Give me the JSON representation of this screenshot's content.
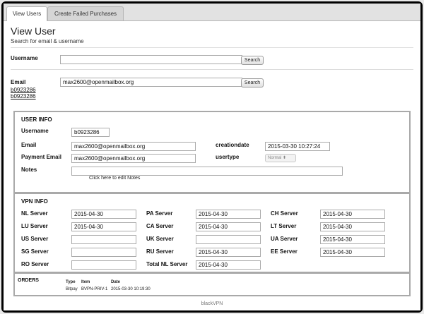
{
  "tabs": [
    {
      "label": "View Users",
      "active": true
    },
    {
      "label": "Create Failed Purchases",
      "active": false
    }
  ],
  "page": {
    "title": "View User",
    "subtitle": "Search for email & username"
  },
  "search": {
    "username_label": "Username",
    "username_value": "",
    "search_button": "Search",
    "email_label": "Email",
    "email_value": "max2600@openmailbox.org",
    "email_search_button": "Search",
    "results": [
      "b0923286",
      "b0923286"
    ]
  },
  "user_info": {
    "title": "USER INFO",
    "username_label": "Username",
    "username_value": "b0923286",
    "email_label": "Email",
    "email_value": "max2600@openmailbox.org",
    "payment_email_label": "Payment Email",
    "payment_email_value": "max2600@openmailbox.org",
    "notes_label": "Notes",
    "notes_value": "",
    "notes_hint": "Click here to edit Notes",
    "creationdate_label": "creationdate",
    "creationdate_value": "2015-03-30 10:27:24",
    "usertype_label": "usertype",
    "usertype_value": "Normal"
  },
  "vpn_info": {
    "title": "VPN INFO",
    "rows": [
      [
        {
          "label": "NL Server",
          "value": "2015-04-30"
        },
        {
          "label": "PA Server",
          "value": "2015-04-30"
        },
        {
          "label": "CH Server",
          "value": "2015-04-30"
        }
      ],
      [
        {
          "label": "LU Server",
          "value": "2015-04-30"
        },
        {
          "label": "CA Server",
          "value": "2015-04-30"
        },
        {
          "label": "LT Server",
          "value": "2015-04-30"
        }
      ],
      [
        {
          "label": "US Server",
          "value": ""
        },
        {
          "label": "UK Server",
          "value": ""
        },
        {
          "label": "UA Server",
          "value": "2015-04-30"
        }
      ],
      [
        {
          "label": "SG Server",
          "value": ""
        },
        {
          "label": "RU Server",
          "value": "2015-04-30"
        },
        {
          "label": "EE Server",
          "value": "2015-04-30"
        }
      ],
      [
        {
          "label": "RO Server",
          "value": ""
        },
        {
          "label": "Total NL Server",
          "value": "2015-04-30"
        }
      ]
    ]
  },
  "orders": {
    "title": "ORDERS",
    "headers": [
      "Type",
      "Item",
      "Date"
    ],
    "rows": [
      {
        "type": "Bitpay",
        "item": "BVPN-PRIV-1",
        "date": "2015-03-30 10:19:30"
      }
    ]
  },
  "footer": "blackVPN"
}
